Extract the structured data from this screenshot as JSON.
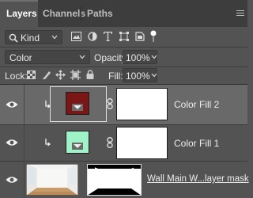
{
  "tabs": [
    {
      "label": "Layers",
      "active": true
    },
    {
      "label": "Channels",
      "active": false
    },
    {
      "label": "Paths",
      "active": false
    }
  ],
  "filter": {
    "kind_label": "Kind",
    "icons": [
      "image-filter-icon",
      "adjustment-filter-icon",
      "type-filter-icon",
      "shape-filter-icon",
      "smart-object-filter-icon",
      "filter-toggle-icon"
    ]
  },
  "blend": {
    "mode": "Color",
    "opacity_label": "Opacity:",
    "opacity_value": "100%"
  },
  "lock": {
    "label": "Lock:",
    "fill_label": "Fill:",
    "fill_value": "100%"
  },
  "layers": [
    {
      "name": "Color Fill 2",
      "swatch": "#7a1616",
      "selected": true,
      "clipped": true
    },
    {
      "name": "Color Fill 1",
      "swatch": "#9ff3c8",
      "selected": false,
      "clipped": true
    },
    {
      "name": "Wall Main W...layer mask",
      "selected": false,
      "clipped": false
    }
  ],
  "colors": {
    "panel_bg": "#535353",
    "tabbar_bg": "#3d3d3d",
    "selected_row": "#696969"
  }
}
